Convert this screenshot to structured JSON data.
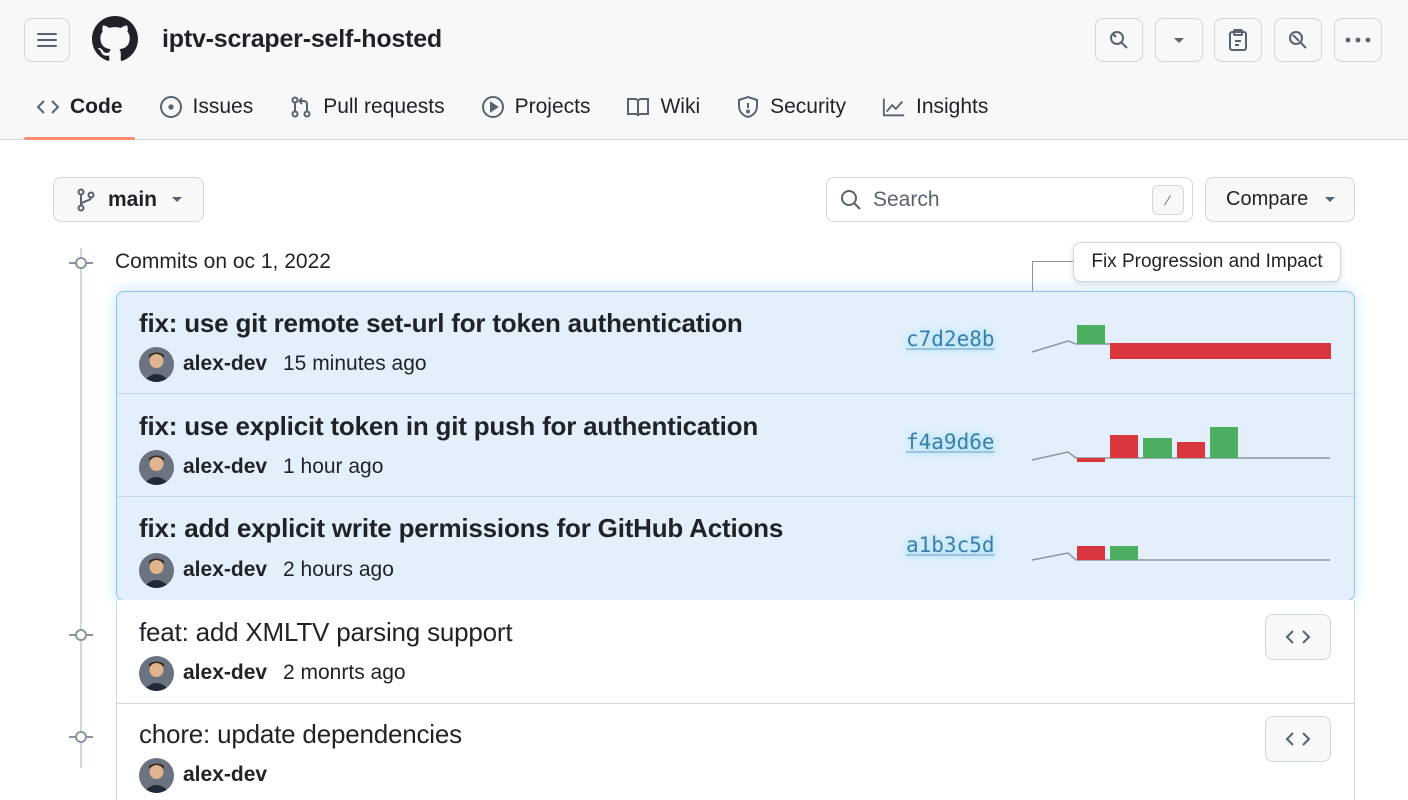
{
  "header": {
    "repo_name": "iptv-scraper-self-hosted",
    "actions": [
      "search-icon",
      "chevron-down-icon",
      "clipboard-icon",
      "search-icon",
      "kebab-icon"
    ]
  },
  "tabs": [
    {
      "label": "Code",
      "icon": "code-icon",
      "active": true
    },
    {
      "label": "Issues",
      "icon": "issue-icon"
    },
    {
      "label": "Pull requests",
      "icon": "pull-request-icon"
    },
    {
      "label": "Projects",
      "icon": "play-icon"
    },
    {
      "label": "Wiki",
      "icon": "book-icon"
    },
    {
      "label": "Security",
      "icon": "shield-icon"
    },
    {
      "label": "Insights",
      "icon": "graph-icon"
    }
  ],
  "toolbar": {
    "branch": "main",
    "search_placeholder": "Search",
    "search_shortcut": "⁄",
    "compare_label": "Compare"
  },
  "timeline": {
    "heading": "Commits on oc 1, 2022",
    "callout": "Fix Progression and Impact"
  },
  "commits": [
    {
      "message": "fix: use git remote set-url for token authentication",
      "author": "alex-dev",
      "time": "15 minutes ago",
      "sha": "c7d2e8b",
      "highlighted": true
    },
    {
      "message": "fix: use explicit token in git push for authentication",
      "author": "alex-dev",
      "time": "1 hour ago",
      "sha": "f4a9d6e",
      "highlighted": true
    },
    {
      "message": "fix: add explicit write permissions for GitHub Actions",
      "author": "alex-dev",
      "time": "2 hours ago",
      "sha": "a1b3c5d",
      "highlighted": true
    },
    {
      "message": "feat: add XMLTV parsing support",
      "author": "alex-dev",
      "time": "2 monrts ago",
      "highlighted": false
    },
    {
      "message": "chore: update dependencies",
      "author": "alex-dev",
      "time": "",
      "highlighted": false
    }
  ],
  "colors": {
    "accent_tab": "#fd8c73",
    "highlight_bg": "#e3f0fc",
    "positive": "#4caf5f",
    "negative": "#d9363e",
    "sha": "#3e7ea6"
  }
}
